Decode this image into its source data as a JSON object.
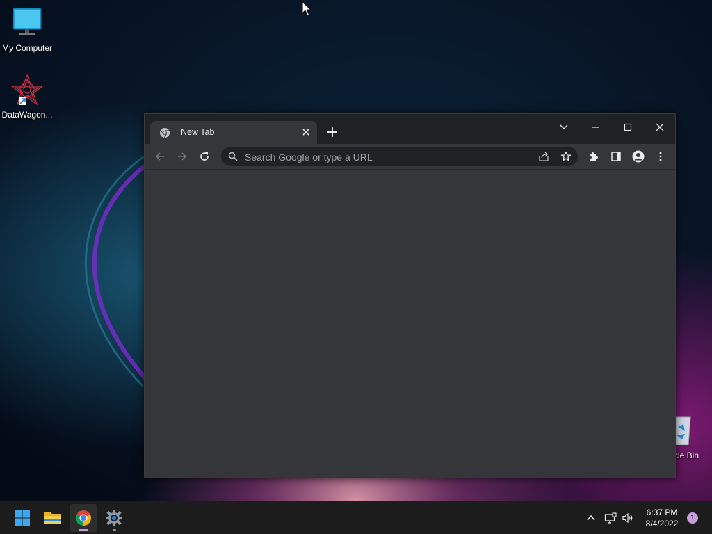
{
  "desktop": {
    "icons": [
      {
        "label": "My Computer",
        "icon": "monitor-icon"
      },
      {
        "label": "DataWagon...",
        "icon": "datawagon-app-icon"
      }
    ],
    "recycle_bin_label": "cle Bin"
  },
  "browser": {
    "tab": {
      "title": "New Tab",
      "favicon": "chrome-favicon-icon"
    },
    "omnibox": {
      "placeholder": "Search Google or type a URL"
    },
    "colors": {
      "frame": "#202124",
      "toolbar": "#35363a",
      "text": "#e8eaed",
      "muted": "#9aa0a6"
    }
  },
  "taskbar": {
    "apps": [
      {
        "name": "start",
        "icon": "windows-start-icon"
      },
      {
        "name": "file-explorer",
        "icon": "folder-icon"
      },
      {
        "name": "chrome",
        "icon": "chrome-icon",
        "active": true
      },
      {
        "name": "settings",
        "icon": "gear-icon"
      }
    ],
    "clock": {
      "time": "6:37 PM",
      "date": "8/4/2022"
    },
    "notification_count": "1",
    "accent": "#c9a0dc"
  }
}
